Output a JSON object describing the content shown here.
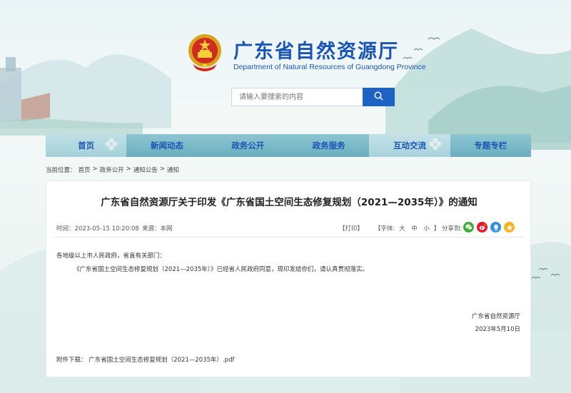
{
  "header": {
    "title_cn": "广东省自然资源厅",
    "title_en": "Department of Natural Resources of Guangdong Province"
  },
  "search": {
    "placeholder": "请输入要搜索的内容"
  },
  "nav": {
    "items": [
      {
        "label": "首页"
      },
      {
        "label": "新闻动态"
      },
      {
        "label": "政务公开"
      },
      {
        "label": "政务服务"
      },
      {
        "label": "互动交流"
      },
      {
        "label": "专题专栏"
      }
    ]
  },
  "breadcrumb": {
    "prefix": "当前位置：",
    "items": [
      "首页",
      "政务公开",
      "通知公告",
      "通知"
    ],
    "separator": ">"
  },
  "article": {
    "title": "广东省自然资源厅关于印发《广东省国土空间生态修复规划（2021—2035年）》的通知",
    "time": "时间：2023-05-15 10:20:08",
    "source": "来源：本网",
    "print": "【打印】",
    "font_label": "【字体:",
    "font_sizes": [
      "大",
      "中",
      "小"
    ],
    "font_close": "】",
    "share_label": "分享到:",
    "greeting": "各地级以上市人民政府，省直有关部门：",
    "content": "《广东省国土空间生态修复规划（2021—2035年）》已经省人民政府同意，现印发给你们，请认真贯彻落实。",
    "signature": "广东省自然资源厅",
    "date": "2023年5月10日",
    "attachment_label": "附件下载：",
    "attachment_file": "广东省国土空间生态修复规划（2021—2035年）.pdf"
  },
  "colors": {
    "brand": "#1a55b5",
    "search_button": "#1d63c4",
    "nav_bg": "#7bb8c7",
    "share_wechat": "#3cb034",
    "share_weibo": "#e6162d",
    "share_qq": "#2d8fe4",
    "share_qzone": "#f5b324"
  },
  "icons": {
    "search": "search-icon",
    "emblem": "national-emblem-icon",
    "share": [
      "wechat-icon",
      "weibo-icon",
      "qq-icon",
      "qzone-icon"
    ]
  }
}
